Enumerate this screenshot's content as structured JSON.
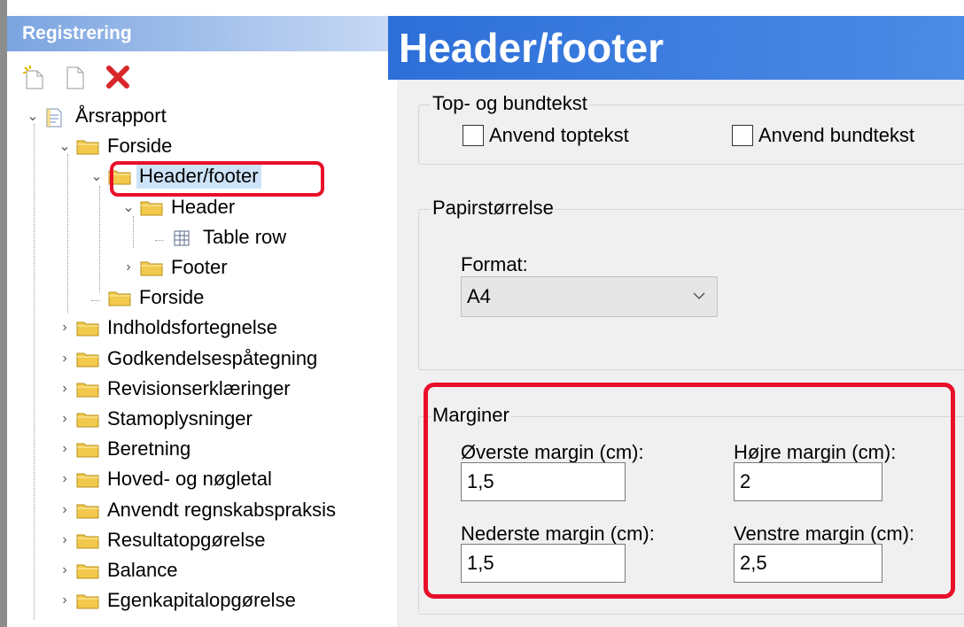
{
  "left_panel": {
    "title": "Registrering",
    "toolbar": [
      {
        "name": "new-icon",
        "label": "new"
      },
      {
        "name": "document-icon",
        "label": "document"
      },
      {
        "name": "delete-icon",
        "label": "delete"
      }
    ],
    "tree": [
      {
        "label": "Årsrapport",
        "depth": 0,
        "expander": "open",
        "icon": "report"
      },
      {
        "label": "Forside",
        "depth": 1,
        "expander": "open",
        "icon": "folder"
      },
      {
        "label": "Header/footer",
        "depth": 2,
        "expander": "open",
        "icon": "folder",
        "selected": true
      },
      {
        "label": "Header",
        "depth": 3,
        "expander": "open",
        "icon": "folder"
      },
      {
        "label": "Table row",
        "depth": 4,
        "expander": "none",
        "icon": "table"
      },
      {
        "label": "Footer",
        "depth": 3,
        "expander": "closed",
        "icon": "folder"
      },
      {
        "label": "Forside",
        "depth": 2,
        "expander": "none",
        "icon": "folder"
      },
      {
        "label": "Indholdsfortegnelse",
        "depth": 1,
        "expander": "closed",
        "icon": "folder"
      },
      {
        "label": "Godkendelsespåtegning",
        "depth": 1,
        "expander": "closed",
        "icon": "folder"
      },
      {
        "label": "Revisionserklæringer",
        "depth": 1,
        "expander": "closed",
        "icon": "folder"
      },
      {
        "label": "Stamoplysninger",
        "depth": 1,
        "expander": "closed",
        "icon": "folder"
      },
      {
        "label": "Beretning",
        "depth": 1,
        "expander": "closed",
        "icon": "folder"
      },
      {
        "label": "Hoved- og nøgletal",
        "depth": 1,
        "expander": "closed",
        "icon": "folder"
      },
      {
        "label": "Anvendt regnskabspraksis",
        "depth": 1,
        "expander": "closed",
        "icon": "folder"
      },
      {
        "label": "Resultatopgørelse",
        "depth": 1,
        "expander": "closed",
        "icon": "folder"
      },
      {
        "label": "Balance",
        "depth": 1,
        "expander": "closed",
        "icon": "folder"
      },
      {
        "label": "Egenkapitalopgørelse",
        "depth": 1,
        "expander": "closed",
        "icon": "folder"
      }
    ]
  },
  "right_panel": {
    "title": "Header/footer",
    "top_bottom_group": {
      "title": "Top- og bundtekst",
      "use_header_label": "Anvend toptekst",
      "use_header_checked": false,
      "use_footer_label": "Anvend bundtekst",
      "use_footer_checked": false
    },
    "paper_group": {
      "title": "Papirstørrelse",
      "format_label": "Format:",
      "format_value": "A4"
    },
    "margins_group": {
      "title": "Marginer",
      "top_label": "Øverste margin (cm):",
      "top_value": "1,5",
      "right_label": "Højre margin (cm):",
      "right_value": "2",
      "bottom_label": "Nederste margin (cm):",
      "bottom_value": "1,5",
      "left_label": "Venstre margin (cm):",
      "left_value": "2,5"
    }
  },
  "colors": {
    "highlight": "#e8102a",
    "title_bar": "#2d6fd8",
    "panel_title": "#7ba4e0",
    "folder": "#f2c94c",
    "selection": "#cde3f7"
  }
}
